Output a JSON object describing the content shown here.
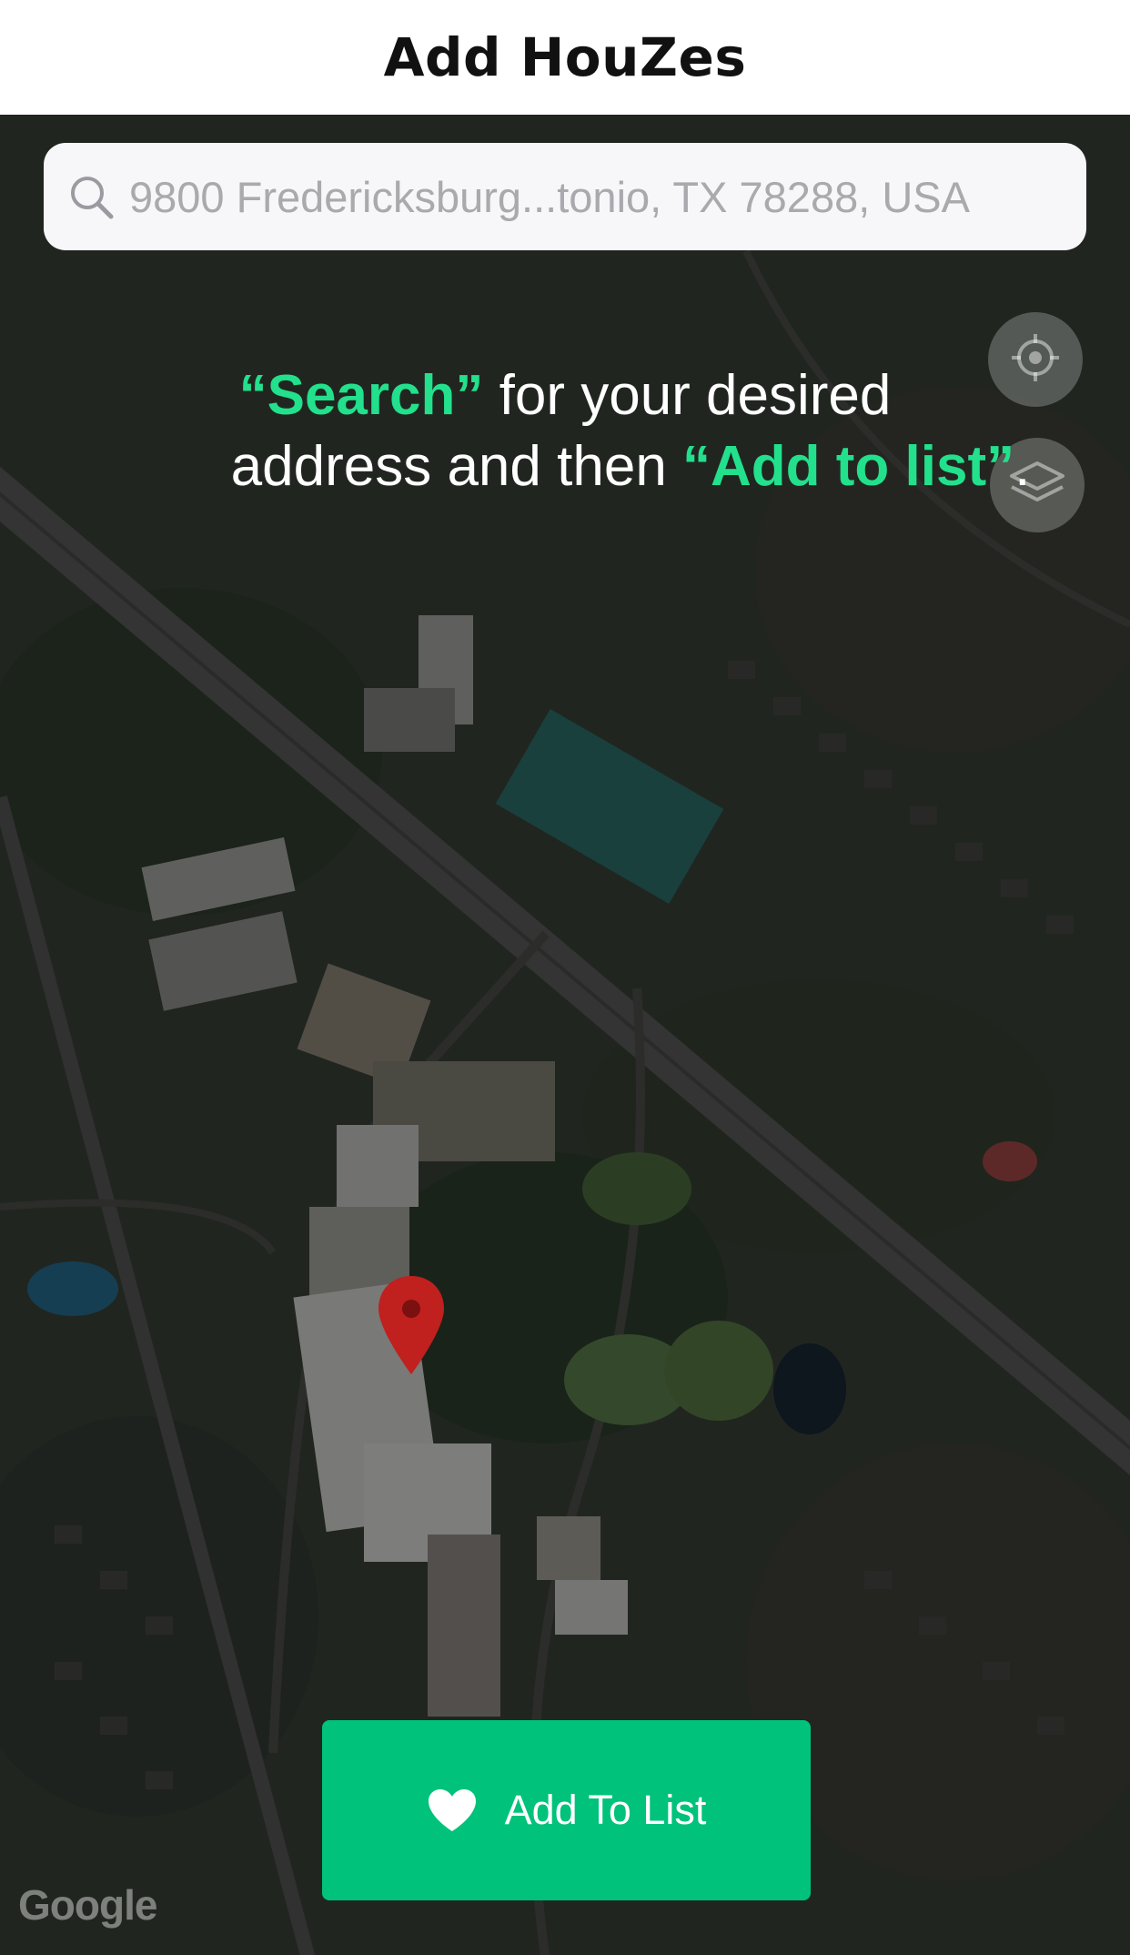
{
  "header": {
    "title": "Add HouZes"
  },
  "search": {
    "value": "9800 Fredericksburg...tonio, TX 78288, USA",
    "icon": "search-icon"
  },
  "map_controls": {
    "locate_icon": "crosshair-icon",
    "layers_icon": "layers-icon"
  },
  "instruction": {
    "search_word": "“Search”",
    "text_1": " for your desired",
    "text_2": "address and then ",
    "add_word": "“Add to list”",
    "end": "."
  },
  "marker": {
    "icon": "map-pin-icon",
    "color": "#c0201e"
  },
  "add_button": {
    "label": "Add To List",
    "icon": "heart-icon"
  },
  "attribution": {
    "text": "Google"
  },
  "colors": {
    "accent": "#00c27a",
    "highlight": "#22e08c"
  }
}
